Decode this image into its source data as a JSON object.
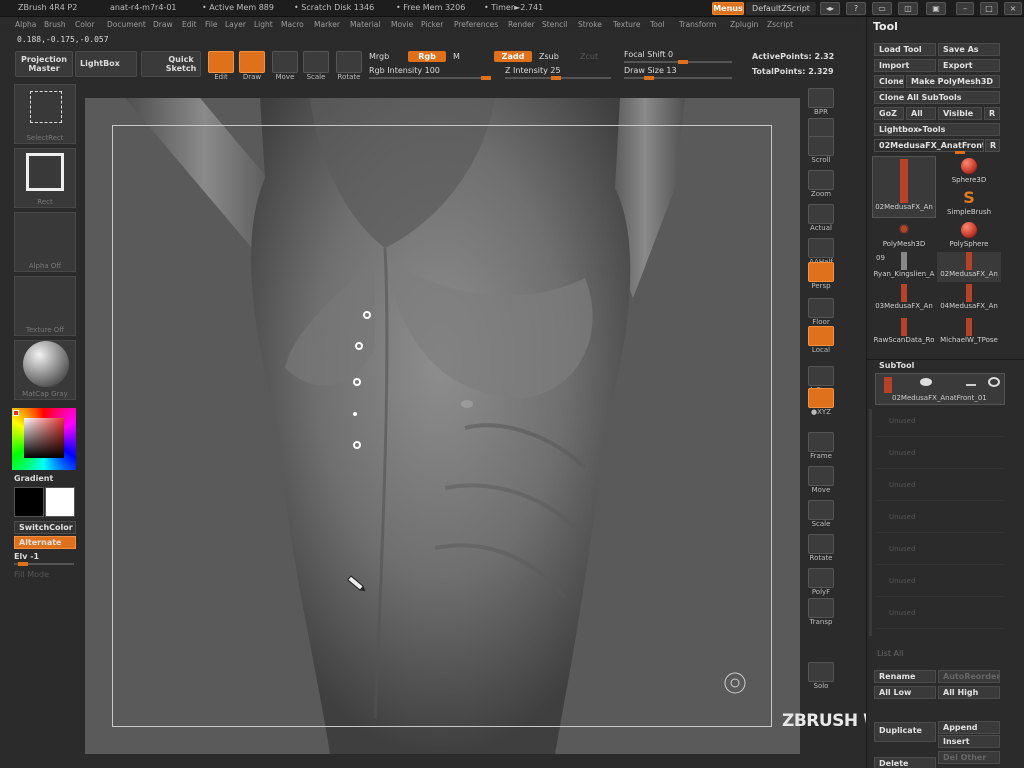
{
  "titlebar": {
    "app": "ZBrush 4R4 P2",
    "doc": "anat-r4-m7r4-01",
    "active_mem": "• Active Mem 889",
    "scratch": "• Scratch Disk 1346",
    "free_mem": "• Free Mem 3206",
    "timer": "• Timer►2.741",
    "menus_btn": "Menus",
    "script_btn": "DefaultZScript"
  },
  "menubar": [
    "Alpha",
    "Brush",
    "Color",
    "Document",
    "Draw",
    "Edit",
    "File",
    "Layer",
    "Light",
    "Macro",
    "Marker",
    "Material",
    "Movie",
    "Picker",
    "Preferences",
    "Render",
    "Stencil",
    "Stroke",
    "Texture",
    "Tool",
    "Transform",
    "Zplugin",
    "Zscript"
  ],
  "coords": "0.188,-0.175,-0.057",
  "toolbar": {
    "projection_master": "Projection Master",
    "lightbox": "LightBox",
    "quick_sketch": "Quick Sketch",
    "edit": "Edit",
    "draw": "Draw",
    "move": "Move",
    "scale": "Scale",
    "rotate": "Rotate",
    "mrgb": "Mrgb",
    "rgb": "Rgb",
    "m": "M",
    "rgb_intensity": "Rgb Intensity 100",
    "zadd": "Zadd",
    "zsub": "Zsub",
    "zcut": "Zcut",
    "z_intensity": "Z Intensity 25",
    "focal_shift": "Focal Shift 0",
    "draw_size": "Draw Size 13",
    "active_points": "ActivePoints: 2.32",
    "total_points": "TotalPoints: 2.329"
  },
  "leftshelf": {
    "select_rect": "SelectRect",
    "rect": "Rect",
    "alpha_off": "Alpha Off",
    "texture_off": "Texture Off",
    "matcap": "MatCap Gray",
    "gradient": "Gradient",
    "switch_color": "SwitchColor",
    "alternate": "Alternate",
    "elv": "Elv -1",
    "fill_mode": "Fill Mode"
  },
  "rightshelf": [
    "BPR",
    "SPix",
    "Scroll",
    "Zoom",
    "Actual",
    "AAHalf",
    "Persp",
    "Floor",
    "Local",
    "L.Sym",
    "●XYZ",
    "Frame",
    "Move",
    "Scale",
    "Rotate",
    "PolyF",
    "Transp",
    "Solo"
  ],
  "toolpanel": {
    "title": "Tool",
    "load_tool": "Load Tool",
    "save_as": "Save As",
    "import": "Import",
    "export": "Export",
    "clone": "Clone",
    "make_polymesh": "Make PolyMesh3D",
    "clone_all": "Clone All SubTools",
    "goz": "GoZ",
    "all": "All",
    "visible": "Visible",
    "r": "R",
    "lightbox_tools": "Lightbox▸Tools",
    "current_tool": "02MedusaFX_AnatFront",
    "tool_number": "09",
    "tiles": [
      "02MedusaFX_An",
      "Sphere3D",
      "SimpleBrush",
      "PolyMesh3D",
      "PolySphere",
      "Ryan_Kingslien_A",
      "02MedusaFX_An",
      "03MedusaFX_An",
      "04MedusaFX_An",
      "RawScanData_Ro",
      "MichaelW_TPose"
    ],
    "subtool_title": "SubTool",
    "subtool_item": "02MedusaFX_AnatFront_01",
    "empty_slot": "Unused",
    "list_all": "List All",
    "rename": "Rename",
    "auto_reorder": "AutoReorder",
    "all_low": "All Low",
    "all_high": "All High",
    "duplicate": "Duplicate",
    "append": "Append",
    "insert": "Insert",
    "delete": "Delete",
    "del_other": "Del Other"
  },
  "watermark": "ZBRUSH WORKSHOPS",
  "colors": {
    "accent": "#e0711c",
    "canvas_bg": "#5a5a5a",
    "ui_bg": "#2b2b2b"
  }
}
